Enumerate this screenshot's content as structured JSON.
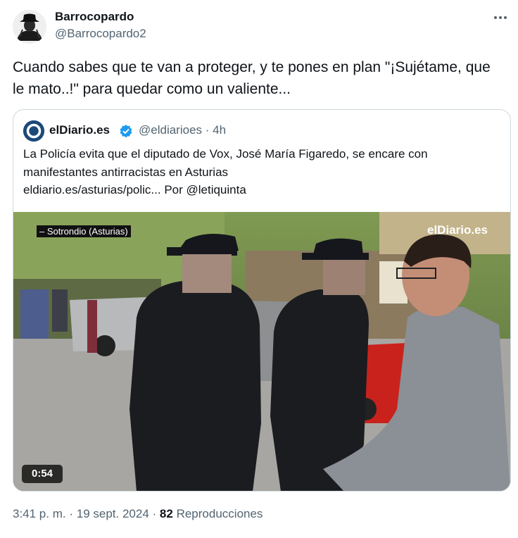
{
  "author": {
    "name": "Barrocopardo",
    "handle": "@Barrocopardo2"
  },
  "more_icon": "more-horizontal-icon",
  "tweet": {
    "text": "Cuando sabes que te van a proteger, y te pones en plan \"¡Sujétame, que le mato..!\" para quedar como un valiente..."
  },
  "quote": {
    "name": "elDiario.es",
    "handle": "@eldiarioes",
    "separator": "·",
    "time": "4h",
    "text_lines": [
      "La Policía evita que el diputado de Vox, José María Figaredo, se encare con",
      "manifestantes antirracistas en Asturias",
      "eldiario.es/asturias/polic... Por @letiquinta"
    ],
    "verified_icon": "verified-badge-icon"
  },
  "video": {
    "location_label": "– Sotrondio (Asturias)",
    "watermark": "elDiario.es",
    "duration": "0:54"
  },
  "meta": {
    "time": "3:41 p. m.",
    "dot1": "·",
    "date": "19 sept. 2024",
    "dot2": "·",
    "views": "82",
    "views_label": "Reproducciones"
  },
  "colors": {
    "text": "#0f1419",
    "secondary": "#536471",
    "border": "#cfd9de",
    "verified": "#1d9bf0"
  }
}
